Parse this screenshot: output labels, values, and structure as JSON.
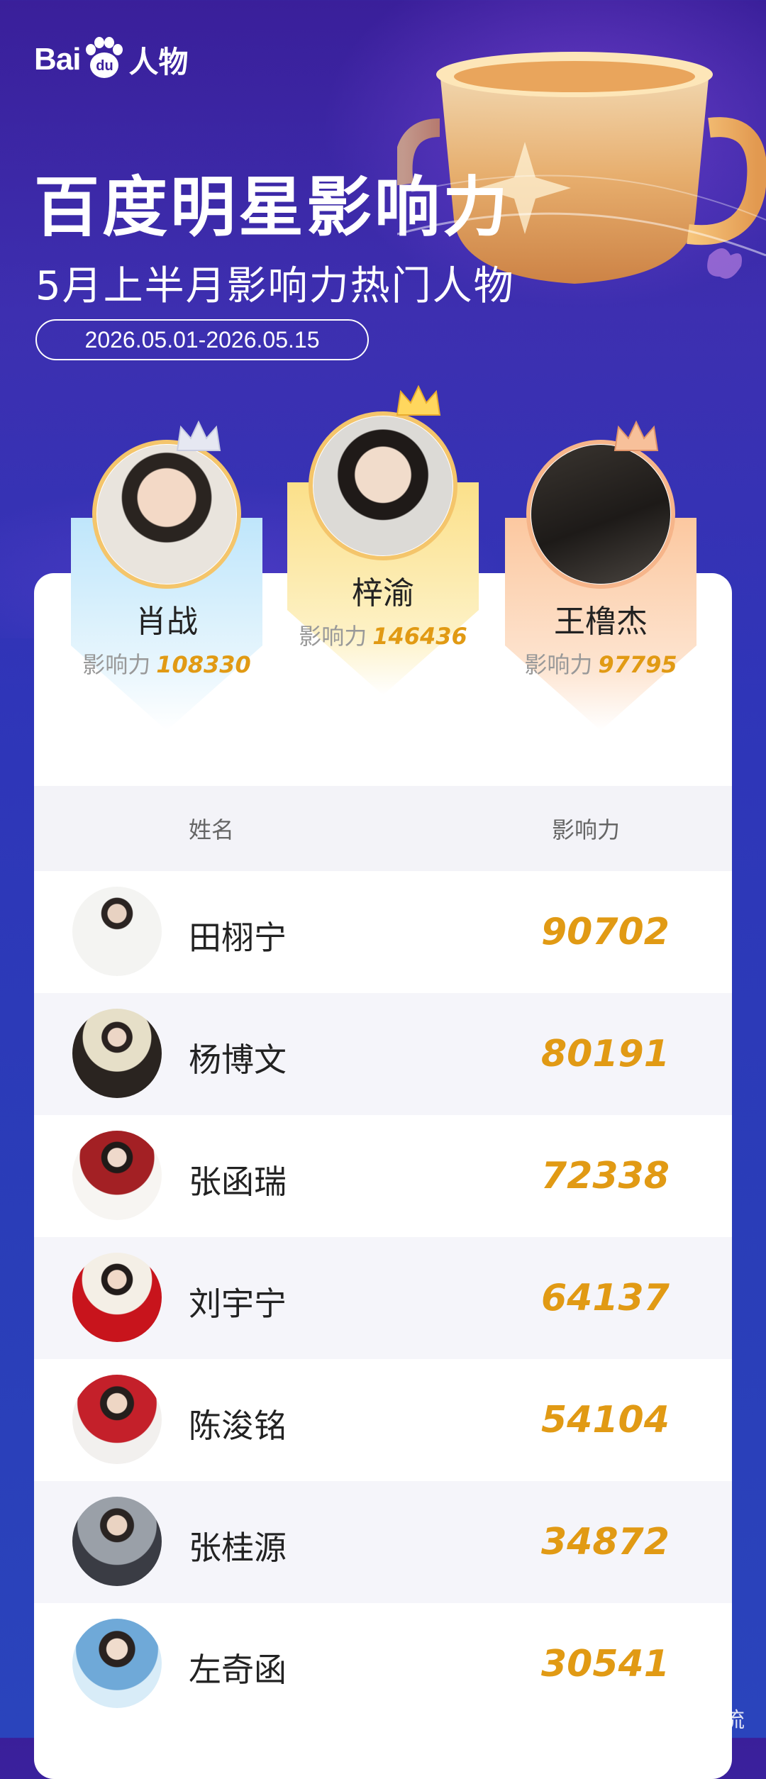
{
  "header": {
    "logo_bai": "Bai",
    "logo_du": "du",
    "logo_suffix": "人物",
    "title": "百度明星影响力",
    "subtitle": "5月上半月影响力热门人物",
    "date_range": "2026.05.01-2026.05.15"
  },
  "podium": [
    {
      "rank": 2,
      "name": "肖战",
      "score_label": "影响力",
      "score": "108330",
      "color": "#bfe6fb"
    },
    {
      "rank": 1,
      "name": "梓渝",
      "score_label": "影响力",
      "score": "146436",
      "color": "#fbe08a"
    },
    {
      "rank": 3,
      "name": "王橹杰",
      "score_label": "影响力",
      "score": "97795",
      "color": "#fcc8a0"
    }
  ],
  "table": {
    "col_name": "姓名",
    "col_score": "影响力",
    "rows": [
      {
        "name": "田栩宁",
        "score": "90702"
      },
      {
        "name": "杨博文",
        "score": "80191"
      },
      {
        "name": "张函瑞",
        "score": "72338"
      },
      {
        "name": "刘宇宁",
        "score": "64137"
      },
      {
        "name": "陈浚铭",
        "score": "54104"
      },
      {
        "name": "张桂源",
        "score": "34872"
      },
      {
        "name": "左奇函",
        "score": "30541"
      }
    ]
  },
  "watermark": "小星潮夫顶流",
  "colors": {
    "accent_gold": "#e19a14",
    "background": "#3a2fb0"
  }
}
